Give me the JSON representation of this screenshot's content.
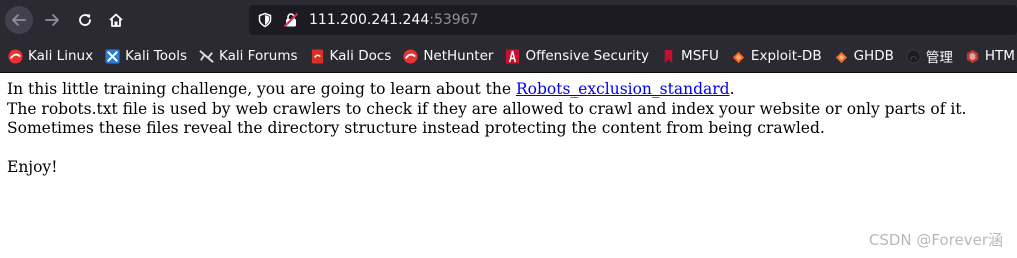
{
  "browser": {
    "url_host": "111.200.241.244",
    "url_port": ":53967",
    "bookmarks": [
      {
        "label": "Kali Linux",
        "icon": "kali-linux-icon",
        "color": "#e9312f"
      },
      {
        "label": "Kali Tools",
        "icon": "kali-tools-icon",
        "color": "#2f7dd1"
      },
      {
        "label": "Kali Forums",
        "icon": "kali-forums-icon",
        "color": "#dcdcdc"
      },
      {
        "label": "Kali Docs",
        "icon": "kali-docs-icon",
        "color": "#d93025"
      },
      {
        "label": "NetHunter",
        "icon": "nethunter-icon",
        "color": "#e9312f"
      },
      {
        "label": "Offensive Security",
        "icon": "offsec-icon",
        "color": "#c8102e"
      },
      {
        "label": "MSFU",
        "icon": "msfu-icon",
        "color": "#c8102e"
      },
      {
        "label": "Exploit-DB",
        "icon": "exploit-db-icon",
        "color": "#ef6c26"
      },
      {
        "label": "GHDB",
        "icon": "ghdb-icon",
        "color": "#ef6c26"
      },
      {
        "label": "管理",
        "icon": "github-icon",
        "color": "#2b2a33"
      },
      {
        "label": "HTM",
        "icon": "html-icon",
        "color": "#c0392b"
      }
    ]
  },
  "page": {
    "line1_prefix": "In this little training challenge, you are going to learn about the ",
    "link_text": "Robots_exclusion_standard",
    "line1_suffix": ".",
    "line2": "The robots.txt file is used by web crawlers to check if they are allowed to crawl and index your website or only parts of it.",
    "line3": "Sometimes these files reveal the directory structure instead protecting the content from being crawled.",
    "line4": "Enjoy!"
  },
  "watermark": "CSDN @Forever涵"
}
